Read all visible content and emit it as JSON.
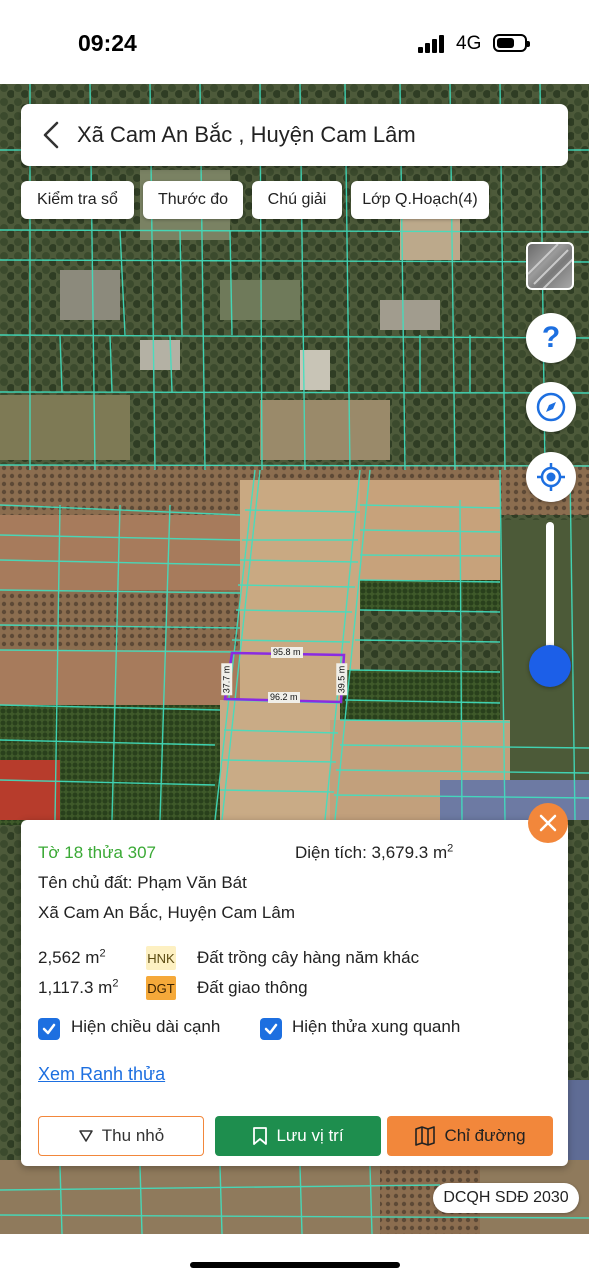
{
  "status_bar": {
    "time": "09:24",
    "network": "4G"
  },
  "header": {
    "title": "Xã Cam An Bắc , Huyện Cam Lâm"
  },
  "chips": [
    {
      "label": "Kiểm tra sổ"
    },
    {
      "label": "Thước đo"
    },
    {
      "label": "Chú giải"
    },
    {
      "label": "Lớp Q.Hoạch(4)"
    }
  ],
  "map": {
    "measurements": {
      "top": "95.8 m",
      "bottom": "96.2 m",
      "left": "37.7 m",
      "right": "39.5 m"
    },
    "parcel_outline_color": "#8a2be2",
    "plot_line_color": "#40e0c0"
  },
  "controls": {
    "help_symbol": "?"
  },
  "info": {
    "parcel_id": "Tờ 18 thửa 307",
    "area_label": "Diện tích: 3,679.3 m",
    "area_sup": "2",
    "owner": "Tên chủ đất: Phạm Văn Bát",
    "address": "Xã Cam An Bắc, Huyện Cam Lâm",
    "land_uses": [
      {
        "area": "2,562 m",
        "sup": "2",
        "code": "HNK",
        "code_bg": "#fdf0c2",
        "code_color": "#5b4a10",
        "desc": "Đất trồng cây hàng năm khác"
      },
      {
        "area": "1,117.3 m",
        "sup": "2",
        "code": "DGT",
        "code_bg": "#f5a93a",
        "code_color": "#3b2200",
        "desc": "Đất giao thông"
      }
    ],
    "checkbox_edges": "Hiện chiều dài cạnh",
    "checkbox_neighbors": "Hiện thửa xung quanh",
    "link": "Xem Ranh thửa",
    "btn_minimize": "Thu nhỏ",
    "btn_save": "Lưu vị trí",
    "btn_directions": "Chỉ đường"
  },
  "badge": "DCQH SDĐ 2030",
  "colors": {
    "green": "#1e8e4e",
    "orange": "#f2873b",
    "blue": "#1d6fe0"
  }
}
